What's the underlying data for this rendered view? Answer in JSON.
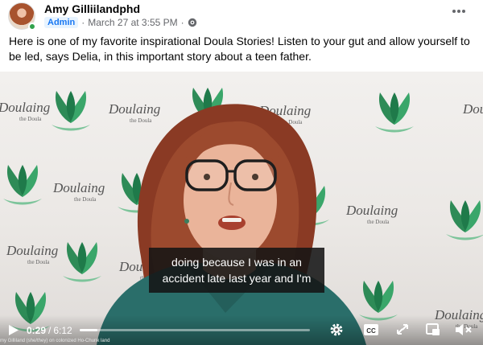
{
  "post": {
    "author": "Amy Gilliilandphd",
    "role_badge": "Admin",
    "timestamp": "March 27 at 3:55 PM",
    "separator": "·",
    "text": "Here is one of my favorite inspirational Doula Stories! Listen to your gut and allow yourself to be led, says Delia, in this important story about a teen father."
  },
  "video": {
    "backdrop_logo_text": "Doulaing",
    "backdrop_logo_subtext": "the Doula",
    "subtitle_line1": "doing because I was in an",
    "subtitle_line2": "accident late last year and I'm",
    "caption_strip": "my  Gilliland (she/they) on colonized Ho-Chunk land",
    "controls": {
      "current_time": "0:29",
      "time_separator": "/",
      "duration": "6:12",
      "progress_fraction": 0.078,
      "play_icon": "play-icon",
      "settings_icon": "gear-icon",
      "captions_icon": "cc-icon",
      "fullscreen_icon": "expand-icon",
      "pip_icon": "picture-in-picture-icon",
      "mute_icon": "muted-speaker-icon"
    }
  },
  "colors": {
    "brand_blue": "#1877f2",
    "online_green": "#31a24c",
    "logo_green": "#2e8b57"
  }
}
